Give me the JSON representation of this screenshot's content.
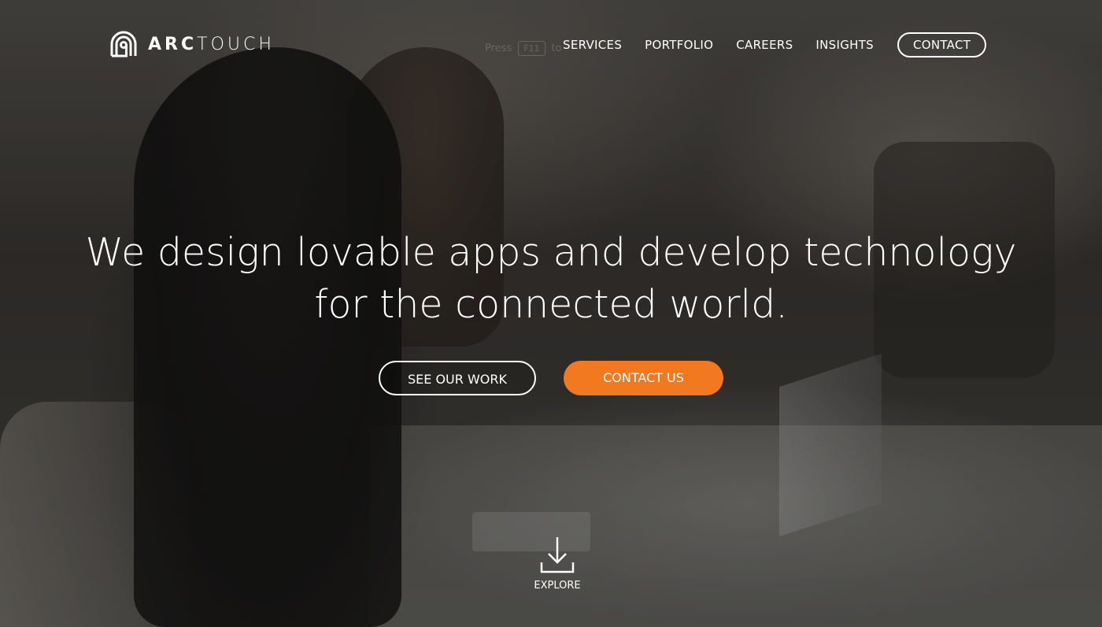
{
  "brand": {
    "logo_bold": "ARC",
    "logo_light": "TOUCH",
    "logo_icon": "arctouch-logo-icon"
  },
  "fullscreen_hint": {
    "prefix": "Press",
    "key": "F11",
    "suffix": "to"
  },
  "nav": {
    "items": [
      {
        "label": "SERVICES"
      },
      {
        "label": "PORTFOLIO"
      },
      {
        "label": "CAREERS"
      },
      {
        "label": "INSIGHTS"
      }
    ],
    "contact_label": "CONTACT"
  },
  "hero": {
    "headline_line1": "We design lovable apps and develop technology",
    "headline_line2": "for the connected world.",
    "see_work_label": "SEE OUR WORK",
    "contact_us_label": "CONTACT US",
    "explore_label": "EXPLORE",
    "explore_icon": "download-arrow-icon"
  },
  "colors": {
    "accent": "#f37920",
    "text": "#ffffff"
  }
}
